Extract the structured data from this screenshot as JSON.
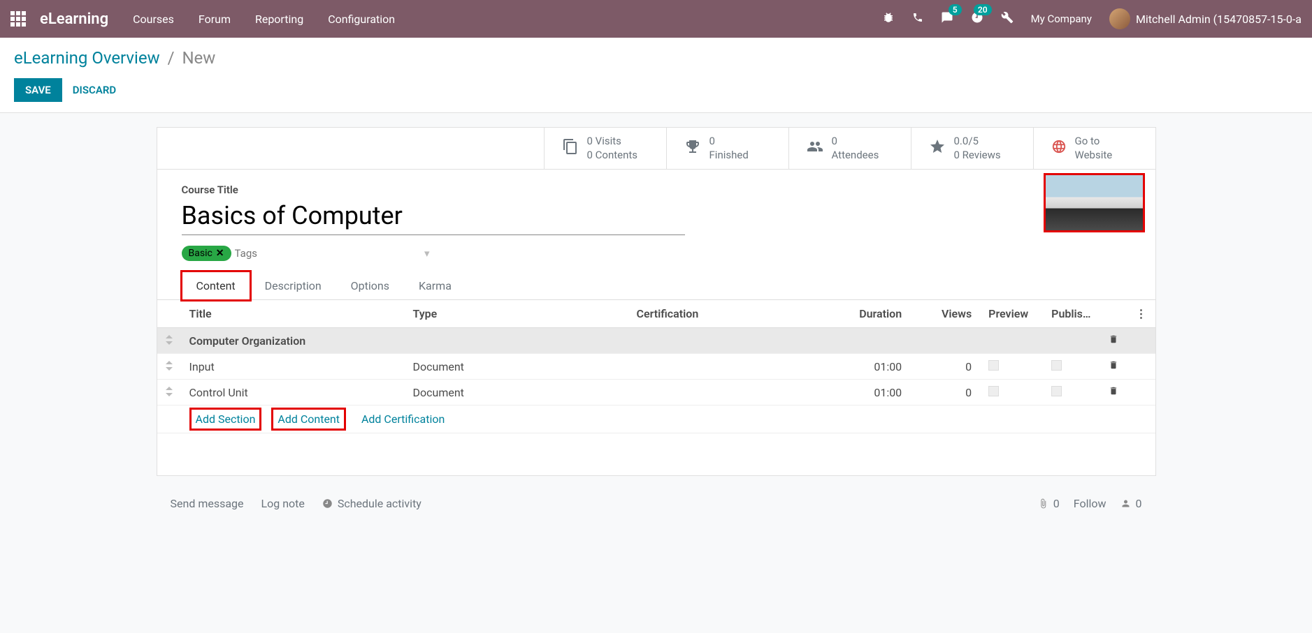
{
  "navbar": {
    "brand": "eLearning",
    "links": [
      "Courses",
      "Forum",
      "Reporting",
      "Configuration"
    ],
    "msg_count": "5",
    "activity_count": "20",
    "company": "My Company",
    "user": "Mitchell Admin (15470857-15-0-a"
  },
  "breadcrumb": {
    "parent": "eLearning Overview",
    "current": "New"
  },
  "actions": {
    "save": "SAVE",
    "discard": "DISCARD"
  },
  "stats": {
    "visits_line1": "0 Visits",
    "visits_line2": "0 Contents",
    "finished_num": "0",
    "finished_label": "Finished",
    "attendees_num": "0",
    "attendees_label": "Attendees",
    "rating": "0.0/5",
    "reviews": "0 Reviews",
    "goto_line1": "Go to",
    "goto_line2": "Website"
  },
  "form": {
    "title_label": "Course Title",
    "title_value": "Basics of Computer",
    "tags": [
      {
        "label": "Basic"
      }
    ],
    "tags_placeholder": "Tags"
  },
  "tabs": {
    "content": "Content",
    "description": "Description",
    "options": "Options",
    "karma": "Karma"
  },
  "table": {
    "headers": {
      "title": "Title",
      "type": "Type",
      "certification": "Certification",
      "duration": "Duration",
      "views": "Views",
      "preview": "Preview",
      "published": "Publis…"
    },
    "sections": [
      {
        "title": "Computer Organization",
        "rows": [
          {
            "title": "Input",
            "type": "Document",
            "certification": "",
            "duration": "01:00",
            "views": "0"
          },
          {
            "title": "Control Unit",
            "type": "Document",
            "certification": "",
            "duration": "01:00",
            "views": "0"
          }
        ]
      }
    ],
    "add_section": "Add Section",
    "add_content": "Add Content",
    "add_certification": "Add Certification"
  },
  "chatter": {
    "send": "Send message",
    "log": "Log note",
    "schedule": "Schedule activity",
    "attach_count": "0",
    "follow": "Follow",
    "follower_count": "0"
  }
}
